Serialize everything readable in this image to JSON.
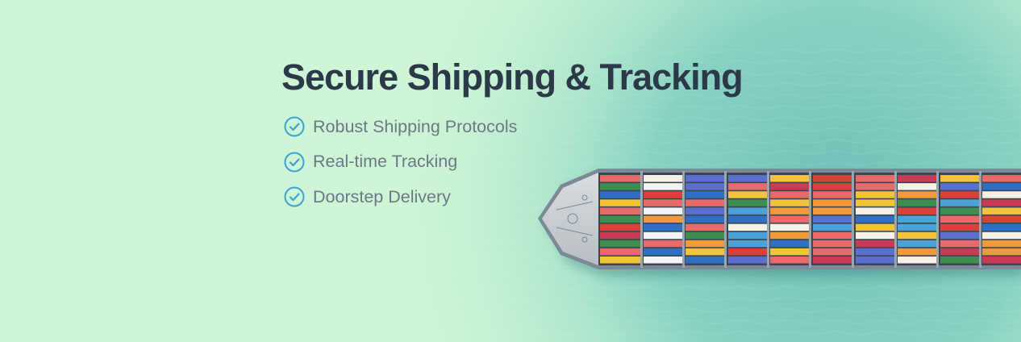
{
  "banner": {
    "headline": "Secure Shipping & Tracking",
    "features": [
      {
        "label": "Robust Shipping Protocols",
        "icon": "check-circle-icon"
      },
      {
        "label": "Real-time Tracking",
        "icon": "check-circle-icon"
      },
      {
        "label": "Doorstep Delivery",
        "icon": "check-circle-icon"
      }
    ]
  },
  "colors": {
    "background": "#cdf5d6",
    "sea": "#7cc9bd",
    "headline": "#2c3949",
    "feature_text": "#6c7885",
    "check_accent": "#3aa3d8"
  }
}
